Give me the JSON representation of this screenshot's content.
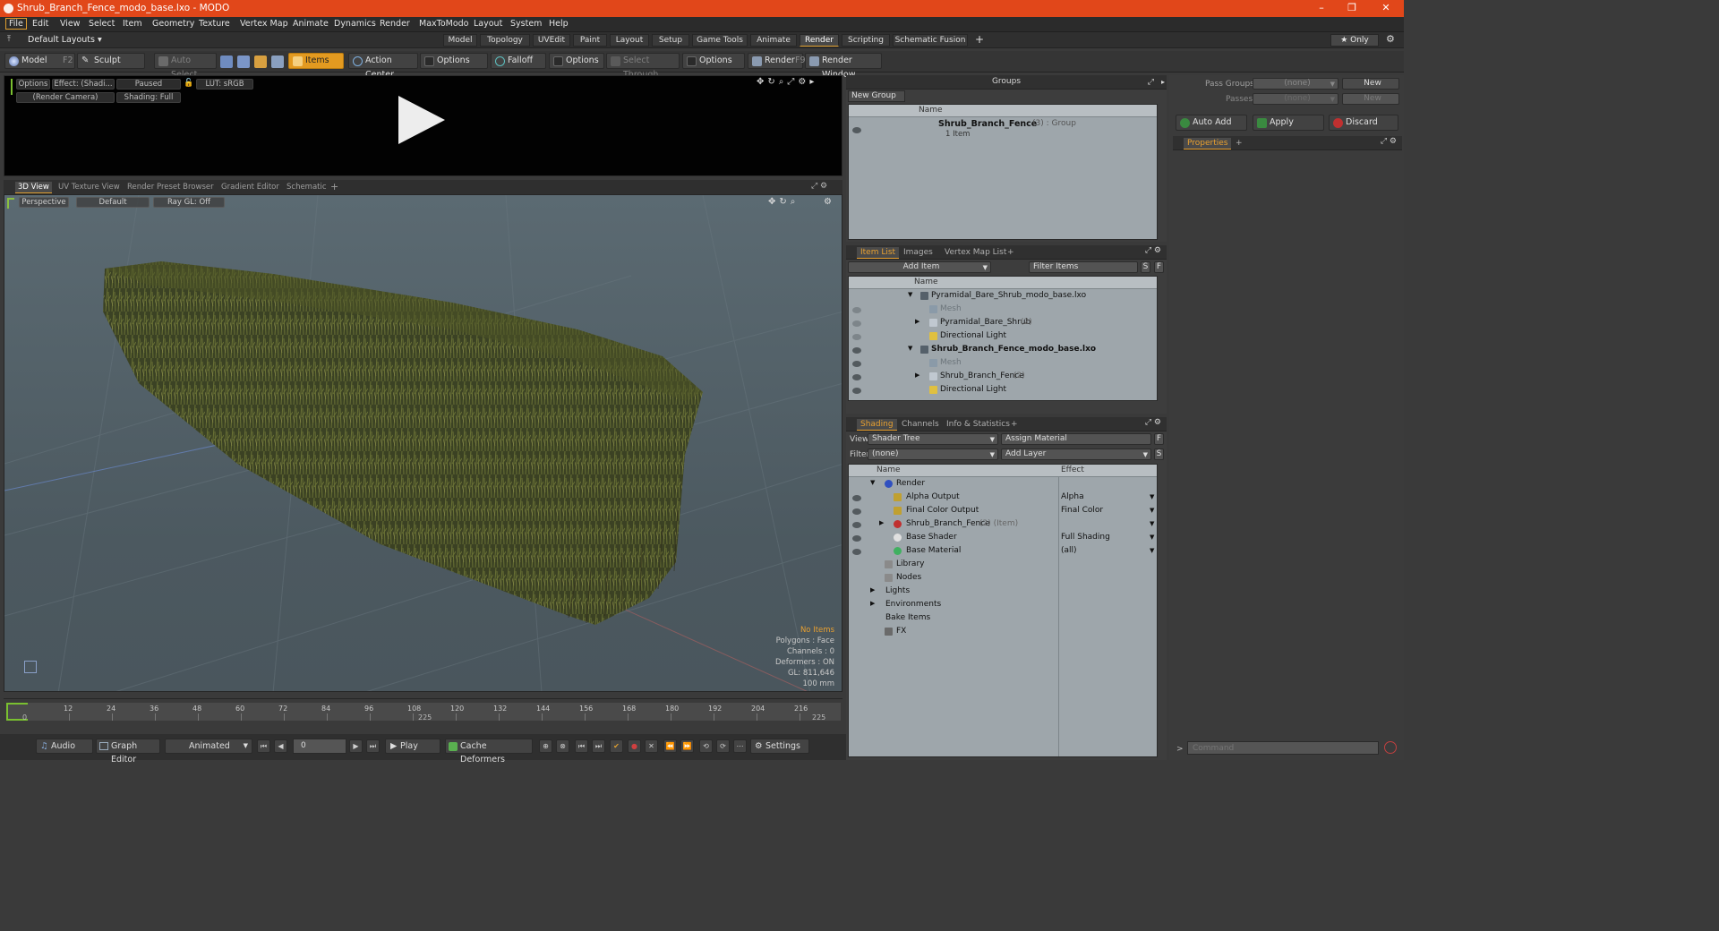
{
  "window": {
    "title": "Shrub_Branch_Fence_modo_base.lxo - MODO",
    "minimize": "–",
    "maximize": "❐",
    "close": "✕"
  },
  "menu": [
    "File",
    "Edit",
    "View",
    "Select",
    "Item",
    "Geometry",
    "Texture",
    "Vertex Map",
    "Animate",
    "Dynamics",
    "Render",
    "MaxToModo",
    "Layout",
    "System",
    "Help"
  ],
  "layouts": {
    "selector": "Default Layouts ▾",
    "tabs": [
      "Model",
      "Topology",
      "UVEdit",
      "Paint",
      "Layout",
      "Setup",
      "Game Tools",
      "Animate",
      "Render",
      "Scripting",
      "Schematic Fusion"
    ],
    "active": "Render",
    "add": "+",
    "only": "★  Only"
  },
  "toolbar": {
    "model": "Model",
    "model_key": "F2",
    "sculpt": "Sculpt",
    "auto_select": "Auto Select",
    "items": "Items",
    "action_center": "Action Center",
    "options1": "Options",
    "falloff": "Falloff",
    "options2": "Options",
    "select_through": "Select Through",
    "options3": "Options",
    "render": "Render",
    "render_key": "F9",
    "render_window": "Render Window"
  },
  "preview": {
    "options": "Options",
    "effect": "Effect: (Shadi...",
    "paused": "Paused",
    "lut": "LUT: sRGB",
    "camera": "(Render Camera)",
    "shading": "Shading: Full"
  },
  "viewport_tabs": [
    "3D View",
    "UV Texture View",
    "Render Preset Browser",
    "Gradient Editor",
    "Schematic",
    "+"
  ],
  "viewport": {
    "perspective": "Perspective",
    "default": "Default",
    "raygl": "Ray GL: Off",
    "info": {
      "no_items": "No Items",
      "polygons": "Polygons : Face",
      "channels": "Channels : 0",
      "deformers": "Deformers : ON",
      "gl": "GL: 811,646",
      "scale": "100 mm"
    }
  },
  "timeline": {
    "ticks": [
      "0",
      "12",
      "24",
      "36",
      "48",
      "60",
      "72",
      "84",
      "96",
      "108",
      "120",
      "132",
      "144",
      "156",
      "168",
      "180",
      "192",
      "204",
      "216"
    ],
    "start": "0",
    "mid": "225",
    "end": "225"
  },
  "bottom": {
    "audio": "Audio",
    "graph_editor": "Graph Editor",
    "animated": "Animated",
    "frame": "0",
    "play": "Play",
    "cache_deformers": "Cache Deformers",
    "settings": "Settings"
  },
  "groups": {
    "title": "Groups",
    "new_group": "New Group",
    "col_name": "Name",
    "item_name": "Shrub_Branch_Fence",
    "item_count": " (3) : Group",
    "item_sub": "1 Item"
  },
  "itemlist": {
    "tabs": [
      "Item List",
      "Images",
      "Vertex Map List",
      "+"
    ],
    "add_item": "Add Item",
    "filter": "Filter Items",
    "s": "S",
    "f": "F",
    "col_name": "Name",
    "rows": [
      {
        "label": "Pyramidal_Bare_Shrub_modo_base.lxo",
        "bold": false
      },
      {
        "label": "Mesh",
        "dim": true
      },
      {
        "label": "Pyramidal_Bare_Shrub",
        "suffix": " (2)"
      },
      {
        "label": "Directional Light"
      },
      {
        "label": "Shrub_Branch_Fence_modo_base.lxo",
        "bold": true
      },
      {
        "label": "Mesh",
        "dim": true
      },
      {
        "label": "Shrub_Branch_Fence",
        "suffix": " (2)"
      },
      {
        "label": "Directional Light"
      }
    ]
  },
  "shading": {
    "tabs": [
      "Shading",
      "Channels",
      "Info & Statistics",
      "+"
    ],
    "view_label": "View",
    "view_value": "Shader Tree",
    "assign": "Assign Material",
    "filter_label": "Filter",
    "filter_value": "(none)",
    "add_layer": "Add Layer",
    "col_name": "Name",
    "col_effect": "Effect",
    "rows": [
      {
        "name": "Render",
        "effect": ""
      },
      {
        "name": "Alpha Output",
        "effect": "Alpha"
      },
      {
        "name": "Final Color Output",
        "effect": "Final Color"
      },
      {
        "name": "Shrub_Branch_Fence",
        "suffix": " (2) (Item)",
        "effect": ""
      },
      {
        "name": "Base Shader",
        "effect": "Full Shading"
      },
      {
        "name": "Base Material",
        "effect": "(all)"
      },
      {
        "name": "Library",
        "effect": ""
      },
      {
        "name": "Nodes",
        "effect": ""
      },
      {
        "name": "Lights",
        "effect": ""
      },
      {
        "name": "Environments",
        "effect": ""
      },
      {
        "name": "Bake Items",
        "effect": ""
      },
      {
        "name": "FX",
        "effect": ""
      }
    ]
  },
  "passes": {
    "pass_groups": "Pass Groups",
    "passes": "Passes",
    "none": "(none)",
    "new": "New",
    "auto_add": "Auto Add",
    "apply": "Apply",
    "discard": "Discard",
    "properties": "Properties",
    "plus": "+"
  },
  "command": {
    "placeholder": "Command",
    "prompt": ">"
  }
}
